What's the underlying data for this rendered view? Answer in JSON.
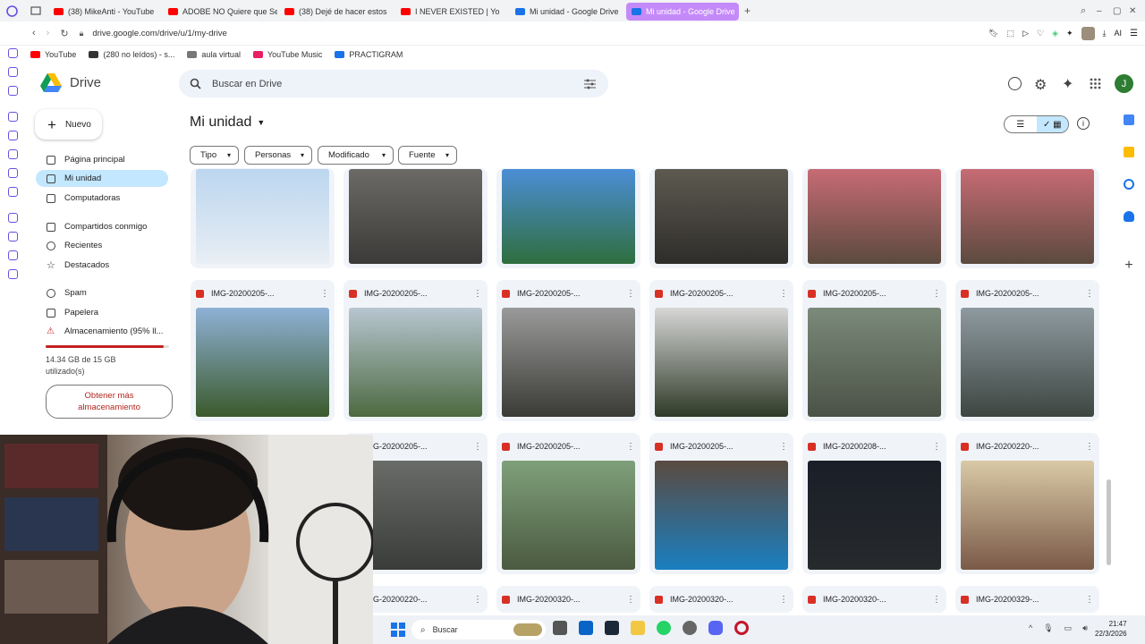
{
  "browser": {
    "tabs": [
      {
        "title": "(38) MikeAnti - YouTube",
        "color": "#ff0000"
      },
      {
        "title": "ADOBE NO Quiere que Se",
        "color": "#ff0000"
      },
      {
        "title": "(38) Dejé de hacer estos",
        "color": "#ff0000"
      },
      {
        "title": "I NEVER EXISTED | Yo",
        "color": "#ff0000"
      },
      {
        "title": "Mi unidad - Google Drive",
        "color": "#1a73e8"
      },
      {
        "title": "Mi unidad - Google Drive",
        "color": "#1a73e8"
      }
    ],
    "new_tab": "+",
    "url": "drive.google.com/drive/u/1/my-drive",
    "ai_label": "AI",
    "bookmarks": [
      "YouTube",
      "(280 no leídos) - s...",
      "aula virtual",
      "YouTube Music",
      "PRACTIGRAM"
    ]
  },
  "drive": {
    "app_name": "Drive",
    "search_placeholder": "Buscar en Drive",
    "avatar_letter": "J",
    "new_button": "Nuevo",
    "nav": {
      "home": "Página principal",
      "my_drive": "Mi unidad",
      "computers": "Computadoras",
      "shared": "Compartidos conmigo",
      "recent": "Recientes",
      "starred": "Destacados",
      "spam": "Spam",
      "trash": "Papelera",
      "storage": "Almacenamiento (95% ll..."
    },
    "storage": {
      "usage_line1": "14.34 GB de 15 GB",
      "usage_line2": "utilizado(s)",
      "used_fraction": 0.956,
      "get_more_line1": "Obtener más",
      "get_more_line2": "almacenamiento"
    },
    "page_title": "Mi unidad",
    "filters": [
      "Tipo",
      "Personas",
      "Modificado",
      "Fuente"
    ],
    "files_row1": [
      {
        "name": "",
        "colors": [
          "#bcd6ef",
          "#e8eef4"
        ]
      },
      {
        "name": "",
        "colors": [
          "#6b6a66",
          "#3c3a38"
        ]
      },
      {
        "name": "",
        "colors": [
          "#4b8ed6",
          "#2f6e3e"
        ]
      },
      {
        "name": "",
        "colors": [
          "#5d5a50",
          "#2f2d2a"
        ]
      },
      {
        "name": "",
        "colors": [
          "#c76b74",
          "#5b4a3f"
        ]
      },
      {
        "name": "",
        "colors": [
          "#c76b74",
          "#5b4a3f"
        ]
      }
    ],
    "files_row2": [
      {
        "name": "IMG-20200205-...",
        "colors": [
          "#8fb2d6",
          "#3b5a2c"
        ]
      },
      {
        "name": "IMG-20200205-...",
        "colors": [
          "#b8c6d1",
          "#4c6a41"
        ]
      },
      {
        "name": "IMG-20200205-...",
        "colors": [
          "#9a9a9a",
          "#3a3a36"
        ]
      },
      {
        "name": "IMG-20200205-...",
        "colors": [
          "#d7d7d7",
          "#2e3a27"
        ]
      },
      {
        "name": "IMG-20200205-...",
        "colors": [
          "#7b8a7a",
          "#4a5246"
        ]
      },
      {
        "name": "IMG-20200205-...",
        "colors": [
          "#8e9aa0",
          "#3d4641"
        ]
      }
    ],
    "files_row3": [
      {
        "name": "IMG-20200205-...",
        "colors": [
          "#6a6c6a",
          "#3a3c3a"
        ]
      },
      {
        "name": "IMG-20200205-...",
        "colors": [
          "#7fa07a",
          "#4b5a40"
        ]
      },
      {
        "name": "IMG-20200205-...",
        "colors": [
          "#5b4a40",
          "#1a7fc0"
        ]
      },
      {
        "name": "IMG-20200208-...",
        "colors": [
          "#1a1e28",
          "#262a2c"
        ]
      },
      {
        "name": "IMG-20200220-...",
        "colors": [
          "#d9c9a5",
          "#7a5a48"
        ]
      }
    ],
    "files_row4": [
      {
        "name": "IMG-20200220-..."
      },
      {
        "name": "IMG-20200320-..."
      },
      {
        "name": "IMG-20200320-..."
      },
      {
        "name": "IMG-20200320-..."
      },
      {
        "name": "IMG-20200329-..."
      }
    ]
  },
  "taskbar": {
    "search_label": "Buscar",
    "time": "21:47",
    "date": "22/3/2026"
  },
  "colors": {
    "accent": "#c2e7ff",
    "active_tab": "#c58af9",
    "storage_warning": "#c5221f"
  }
}
